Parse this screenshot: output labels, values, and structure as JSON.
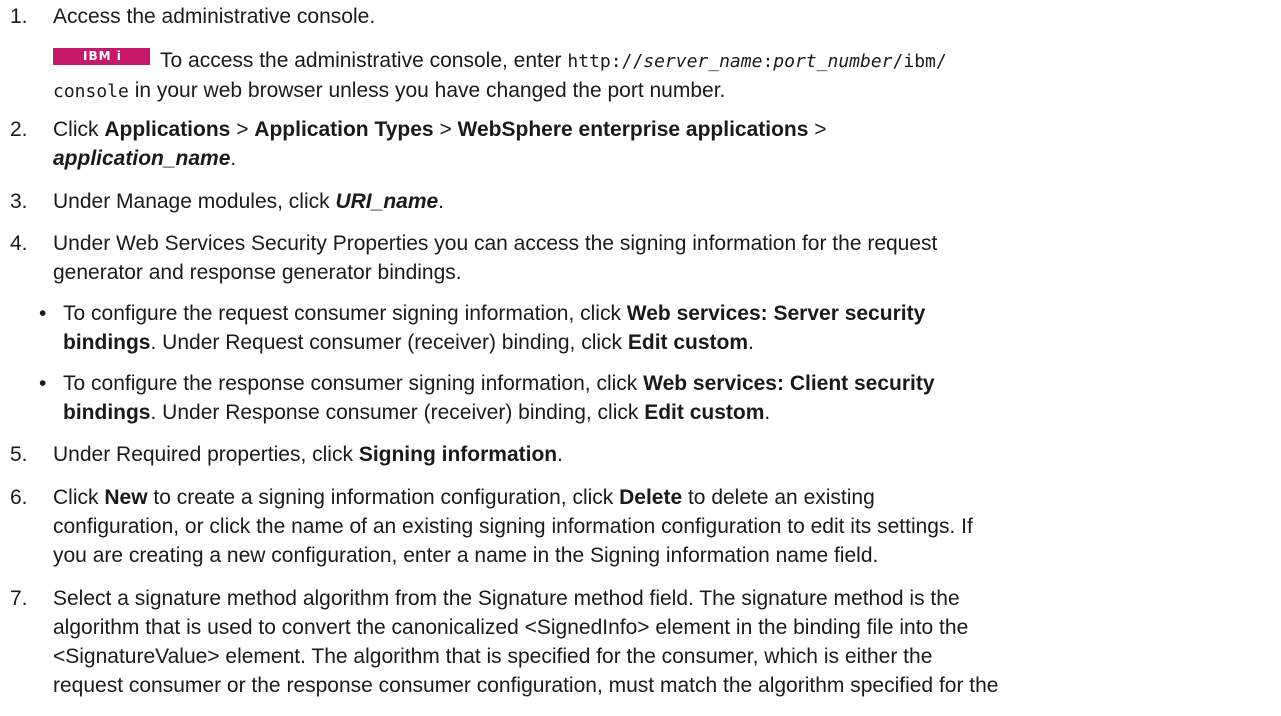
{
  "steps": {
    "s1": {
      "num": "1.",
      "text": "Access the administrative console."
    },
    "s1_note": {
      "badge": "IBM i",
      "pre": "To access the administrative console, enter ",
      "code_a": "http://",
      "code_b": "server_name",
      "code_c": ":",
      "code_d": "port_number",
      "code_e": "/ibm/",
      "code_f": "console",
      "post": " in your web browser unless you have changed the port number."
    },
    "s2": {
      "num": "2.",
      "pre": "Click ",
      "b1": "Applications",
      "sep1": " > ",
      "b2": "Application Types",
      "sep2": " > ",
      "b3": "WebSphere enterprise applications",
      "sep3": " >",
      "b4": "application_name",
      "end": "."
    },
    "s3": {
      "num": "3.",
      "pre": "Under Manage modules, click ",
      "b": "URI_name",
      "end": "."
    },
    "s4": {
      "num": "4.",
      "line1": "Under Web Services Security Properties you can access the signing information for the request",
      "line2": "generator and response generator bindings."
    },
    "b1": {
      "dot": "•",
      "pre": "To configure the request consumer signing information, click ",
      "bold1": "Web services: Server security",
      "bold2": "bindings",
      "mid": ". Under Request consumer (receiver) binding, click ",
      "bold3": "Edit custom",
      "end": "."
    },
    "b2": {
      "dot": "•",
      "pre": "To configure the response consumer signing information, click ",
      "bold1": "Web services: Client security",
      "bold2": "bindings",
      "mid": ". Under Response consumer (receiver) binding, click ",
      "bold3": "Edit custom",
      "end": "."
    },
    "s5": {
      "num": "5.",
      "pre": "Under Required properties, click ",
      "b": "Signing information",
      "end": "."
    },
    "s6": {
      "num": "6.",
      "pre": "Click ",
      "b1": "New",
      "mid1": " to create a signing information configuration, click ",
      "b2": "Delete",
      "mid2": " to delete an existing",
      "line2": "configuration, or click the name of an existing signing information configuration to edit its settings. If",
      "line3": "you are creating a new configuration, enter a name in the Signing information name field."
    },
    "s7": {
      "num": "7.",
      "line1": "Select a signature method algorithm from the Signature method field. The signature method is the",
      "line2": "algorithm that is used to convert the canonicalized <SignedInfo> element in the binding file into the",
      "line3": "<SignatureValue> element. The algorithm that is specified for the consumer, which is either the",
      "line4": "request consumer or the response consumer configuration, must match the algorithm specified for the"
    }
  }
}
